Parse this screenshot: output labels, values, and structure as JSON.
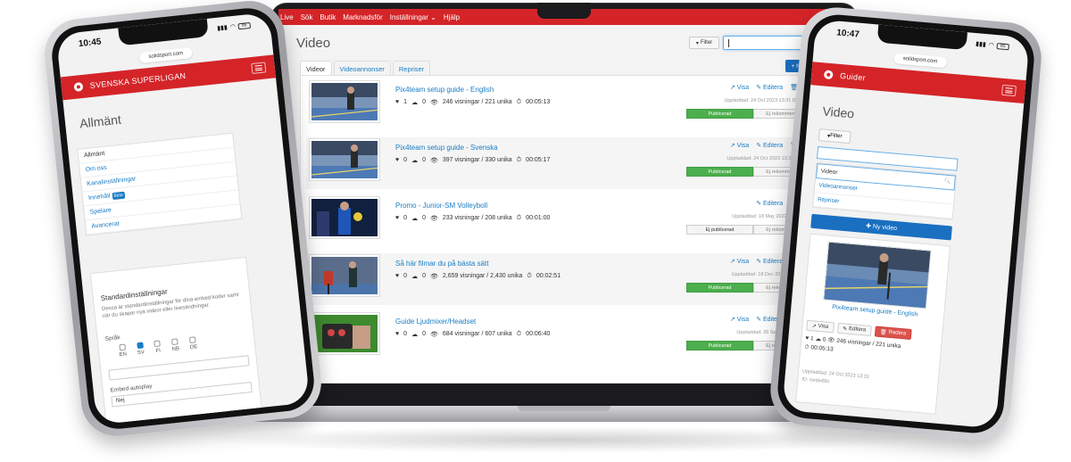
{
  "laptop": {
    "nav": [
      "Live",
      "Sök",
      "Butik",
      "Marknadsför",
      "Inställningar ⌄",
      "Hjälp"
    ],
    "title": "Video",
    "filter_label": "Filter",
    "tabs": [
      "Videor",
      "Videoannonser",
      "Repriser"
    ],
    "new_video_label": "+ Ny video",
    "actions": {
      "view": "Visa",
      "edit": "Editera",
      "delete": "Radera"
    },
    "rows": [
      {
        "title": "Pix4team setup guide - English",
        "likes": "1",
        "dislikes": "0",
        "views": "246 visningar / 221 unika",
        "duration": "00:05:13",
        "meta": "Uppladdad: 24 Oct 2023 13:31   ID: swdw89c",
        "pub": "Publicerad",
        "rec": "Ej rekommenderad",
        "published": true,
        "has_view": true
      },
      {
        "title": "Pix4team setup guide - Svenska",
        "likes": "0",
        "dislikes": "0",
        "views": "397 visningar / 330 unika",
        "duration": "00:05:17",
        "meta": "Uppladdad: 24 Oct 2023 13:30   ID: t47ju20t",
        "pub": "Publicerad",
        "rec": "Ej rekommenderad",
        "published": true,
        "has_view": true
      },
      {
        "title": "Promo - Junior-SM Volleyboll",
        "likes": "0",
        "dislikes": "0",
        "views": "233 visningar / 208 unika",
        "duration": "00:01:00",
        "meta": "Uppladdad: 18 May 2022 09:46   ID: voe2",
        "pub": "Ej publicerad",
        "rec": "Ej rekommenderad",
        "published": false,
        "has_view": false
      },
      {
        "title": "Så här filmar du på bästa sätt",
        "likes": "0",
        "dislikes": "0",
        "views": "2,659 visningar / 2,430 unika",
        "duration": "00:02:51",
        "meta": "Uppladdad: 18 Dec 2019 12:25   ID: bdwn",
        "pub": "Publicerad",
        "rec": "Ej rekommenderad",
        "published": true,
        "has_view": true
      },
      {
        "title": "Guide Ljudmixer/Headset",
        "likes": "0",
        "dislikes": "0",
        "views": "684 visningar / 607 unika",
        "duration": "00:06:40",
        "meta": "Uppladdad: 26 Sep 2019 13:50   ID: 4ju",
        "pub": "Publicerad",
        "rec": "Ej rekommenderad",
        "published": true,
        "has_view": true
      }
    ]
  },
  "phone_left": {
    "time": "10:45",
    "battery": "85",
    "url": "solidsport.com",
    "brand": "SVENSKA SUPERLIGAN",
    "heading": "Allmänt",
    "menu": [
      "Allmänt",
      "Om oss",
      "Kanalinställningar",
      "Innehåll",
      "Spelare",
      "Avancerat"
    ],
    "beta_label": "Beta",
    "settings_title": "Standardinställningar",
    "settings_desc": "Dessa är standardinställningar för dina embed koder samt när du skapar nya videor eller livesändningar.",
    "language_label": "Språk",
    "languages": [
      "EN",
      "SV",
      "FI",
      "NB",
      "DE"
    ],
    "autoplay_label": "Embed autoplay",
    "autoplay_value": "Nej"
  },
  "phone_right": {
    "time": "10:47",
    "battery": "85",
    "url": "solidsport.com",
    "brand": "Guider",
    "heading": "Video",
    "filter_label": "Filter",
    "select_value": "Videor",
    "list": [
      "Videoannonser",
      "Repriser"
    ],
    "new_video_label": "Ny video",
    "card_title": "Pix4team setup guide - English",
    "view_label": "Visa",
    "edit_label": "Editera",
    "delete_label": "Radera",
    "likes": "1",
    "dislikes": "0",
    "views": "246 visningar / 221 unika",
    "duration": "00:05:13",
    "uploaded": "Uppladdad: 24 Oct 2023 13:31",
    "id": "ID: swdw89c"
  },
  "colors": {
    "brand_red": "#d42428",
    "link_blue": "#1a7dc4",
    "publish_green": "#4cae4c",
    "primary_blue": "#1a6fc0"
  }
}
